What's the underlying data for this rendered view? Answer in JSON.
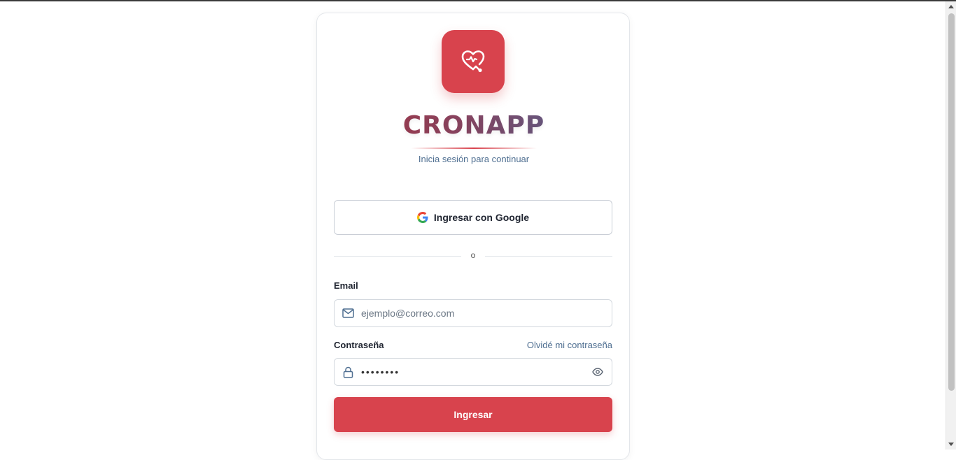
{
  "brand": {
    "name": "CRONAPP",
    "subtitle": "Inicia sesión para continuar",
    "logo_icon": "heart-stethoscope-icon",
    "accent_color": "#d8434d"
  },
  "google": {
    "label": "Ingresar con Google",
    "icon": "google-icon"
  },
  "divider": {
    "text": "o"
  },
  "email": {
    "label": "Email",
    "placeholder": "ejemplo@correo.com",
    "value": "",
    "icon": "mail-icon"
  },
  "password": {
    "label": "Contraseña",
    "forgot_label": "Olvidé mi contraseña",
    "value": "••••••••",
    "icon": "lock-icon",
    "toggle_icon": "eye-icon"
  },
  "submit": {
    "label": "Ingresar"
  }
}
